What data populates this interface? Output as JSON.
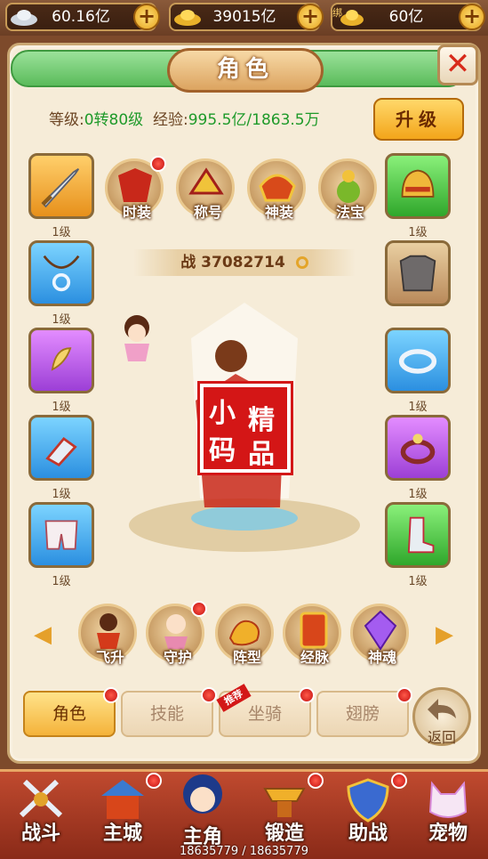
{
  "currency": [
    {
      "value": "60.16亿",
      "icon": "silver-ingot-icon"
    },
    {
      "value": "39015亿",
      "icon": "gold-ingot-icon"
    },
    {
      "value": "60亿",
      "icon": "bound-gold-icon",
      "tag": "绑"
    }
  ],
  "panel": {
    "title": "角色",
    "close": "✕",
    "level_label": "等级:",
    "level_value": "0转80级",
    "exp_label": "经验:",
    "exp_value": "995.5亿/1863.5万",
    "upgrade": "升级",
    "power": "战 37082714"
  },
  "left_slots": [
    {
      "name": "weapon",
      "level": "1级",
      "color": "orange"
    },
    {
      "name": "necklace",
      "level": "1级",
      "color": "blue"
    },
    {
      "name": "amulet",
      "level": "1级",
      "color": "purple"
    },
    {
      "name": "bracer",
      "level": "1级",
      "color": "blue"
    },
    {
      "name": "pants",
      "level": "1级",
      "color": "blue"
    }
  ],
  "right_slots": [
    {
      "name": "helmet",
      "level": "1级",
      "color": "green"
    },
    {
      "name": "armor",
      "level": "",
      "color": "brown"
    },
    {
      "name": "bracelet",
      "level": "1级",
      "color": "blue"
    },
    {
      "name": "ring",
      "level": "1级",
      "color": "purple"
    },
    {
      "name": "boots",
      "level": "1级",
      "color": "green"
    }
  ],
  "top_features": [
    "时装",
    "称号",
    "神装",
    "法宝"
  ],
  "bottom_features": [
    "飞升",
    "守护",
    "阵型",
    "经脉",
    "神魂"
  ],
  "stamp": {
    "c1": "小",
    "c2": "精",
    "c3": "码",
    "c4": "品"
  },
  "tabs": [
    "角色",
    "技能",
    "坐骑",
    "翅膀"
  ],
  "hot_badge": "推荐",
  "back": "返回",
  "nav": [
    "战斗",
    "主城",
    "主角",
    "锻造",
    "助战",
    "宠物"
  ],
  "hp": "18635779 / 18635779",
  "colors": {
    "accent": "#f4b33a",
    "panel": "#f6ecd8",
    "badge": "#d31717"
  }
}
